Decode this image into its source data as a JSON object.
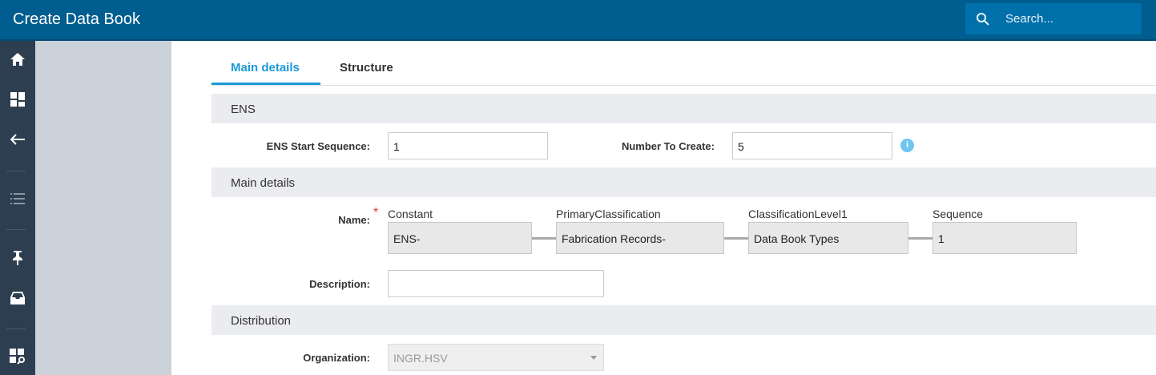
{
  "header": {
    "title": "Create Data Book",
    "search_placeholder": "Search..."
  },
  "sidebar": {
    "items": [
      "home",
      "dashboard",
      "back",
      "list",
      "pin",
      "inbox",
      "search-apps"
    ]
  },
  "tabs": [
    {
      "label": "Main details",
      "active": true
    },
    {
      "label": "Structure",
      "active": false
    }
  ],
  "sections": {
    "ens": "ENS",
    "main": "Main details",
    "distribution": "Distribution"
  },
  "ens": {
    "start_label": "ENS Start Sequence:",
    "start_value": "1",
    "number_label": "Number To Create:",
    "number_value": "5",
    "info_icon": "i"
  },
  "name": {
    "label": "Name:",
    "required": "*",
    "parts": [
      {
        "header": "Constant",
        "value": "ENS-"
      },
      {
        "header": "PrimaryClassification",
        "value": "Fabrication Records-"
      },
      {
        "header": "ClassificationLevel1",
        "value": "Data Book Types"
      },
      {
        "header": "Sequence",
        "value": "1"
      }
    ]
  },
  "description": {
    "label": "Description:",
    "value": ""
  },
  "organization": {
    "label": "Organization:",
    "value": "INGR.HSV"
  },
  "colors": {
    "header": "#005d8f",
    "accent": "#1a9bd7",
    "sidebar": "#2d3e50"
  }
}
